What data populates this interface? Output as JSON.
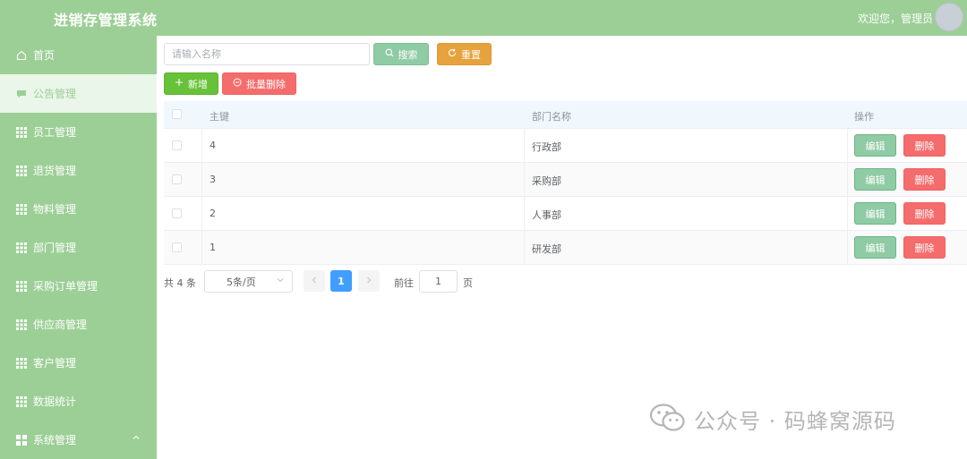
{
  "header": {
    "app_title": "进销存管理系统",
    "welcome": "欢迎您，管理员"
  },
  "sidebar": {
    "items": [
      {
        "label": "首页",
        "icon": "home-icon"
      },
      {
        "label": "公告管理",
        "icon": "message-icon",
        "active": true
      },
      {
        "label": "员工管理",
        "icon": "grid-icon"
      },
      {
        "label": "退货管理",
        "icon": "grid-icon"
      },
      {
        "label": "物料管理",
        "icon": "grid-icon"
      },
      {
        "label": "部门管理",
        "icon": "grid-icon"
      },
      {
        "label": "采购订单管理",
        "icon": "grid-icon"
      },
      {
        "label": "供应商管理",
        "icon": "grid-icon"
      },
      {
        "label": "客户管理",
        "icon": "grid-icon"
      },
      {
        "label": "数据统计",
        "icon": "grid-icon"
      },
      {
        "label": "系统管理",
        "icon": "menu-icon",
        "expanded": true
      }
    ]
  },
  "toolbar": {
    "search_placeholder": "请输入名称",
    "search_value": "",
    "search_label": "搜索",
    "reset_label": "重置",
    "add_label": "新增",
    "batch_delete_label": "批量删除"
  },
  "table": {
    "columns": [
      "主键",
      "部门名称",
      "操作"
    ],
    "rows": [
      {
        "id": "4",
        "name": "行政部"
      },
      {
        "id": "3",
        "name": "采购部"
      },
      {
        "id": "2",
        "name": "人事部"
      },
      {
        "id": "1",
        "name": "研发部"
      }
    ],
    "edit_label": "编辑",
    "delete_label": "删除"
  },
  "pagination": {
    "total_text": "共 4 条",
    "page_size": "5条/页",
    "current_page": "1",
    "goto_label": "前往",
    "goto_value": "1",
    "page_suffix": "页"
  },
  "watermark": {
    "text": "公众号 · 码蜂窝源码"
  },
  "colors": {
    "primary_green": "#9ccf96",
    "search_button": "#8fcba4",
    "reset_button": "#e6a23c",
    "add_button": "#67c23a",
    "danger": "#f56c6c",
    "page_active": "#409eff"
  }
}
